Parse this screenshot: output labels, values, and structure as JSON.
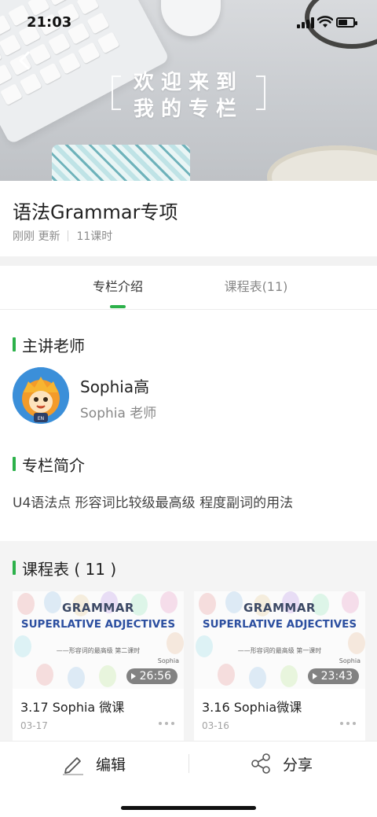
{
  "status_bar": {
    "time": "21:03"
  },
  "banner": {
    "line1": "欢迎来到",
    "line2": "我的专栏"
  },
  "column": {
    "title": "语法Grammar专项",
    "updated": "刚刚 更新",
    "lesson_count": "11课时"
  },
  "tabs": [
    {
      "label": "专栏介绍",
      "active": true
    },
    {
      "label": "课程表(11)",
      "active": false
    }
  ],
  "teacher_section": {
    "heading": "主讲老师",
    "name": "Sophia高",
    "role": "Sophia 老师",
    "avatar_badge": "EN"
  },
  "intro_section": {
    "heading": "专栏简介",
    "text": "U4语法点 形容词比较级最高级 程度副词的用法"
  },
  "schedule_section": {
    "heading": "课程表 ( 11 )"
  },
  "courses": [
    {
      "thumb_line1": "GRAMMAR",
      "thumb_line2": "SUPERLATIVE ADJECTIVES",
      "thumb_line3": "——形容词的最高级 第二课时",
      "thumb_author": "Sophia",
      "duration": "26:56",
      "title": "3.17 Sophia 微课",
      "date": "03-17"
    },
    {
      "thumb_line1": "GRAMMAR",
      "thumb_line2": "SUPERLATIVE ADJECTIVES",
      "thumb_line3": "——形容词的最高级 第一课时",
      "thumb_author": "Sophia",
      "duration": "23:43",
      "title": "3.16 Sophia微课",
      "date": "03-16"
    }
  ],
  "bottom_bar": {
    "edit_label": "编辑",
    "share_label": "分享"
  },
  "icons": {
    "back": "chevron-left-icon",
    "edit": "pencil-icon",
    "share": "share-nodes-icon",
    "play": "play-icon",
    "more": "ellipsis-icon"
  },
  "colors": {
    "accent_green": "#2cb14a",
    "text_primary": "#222222",
    "text_secondary": "#888888",
    "section_bg": "#f4f4f4"
  }
}
